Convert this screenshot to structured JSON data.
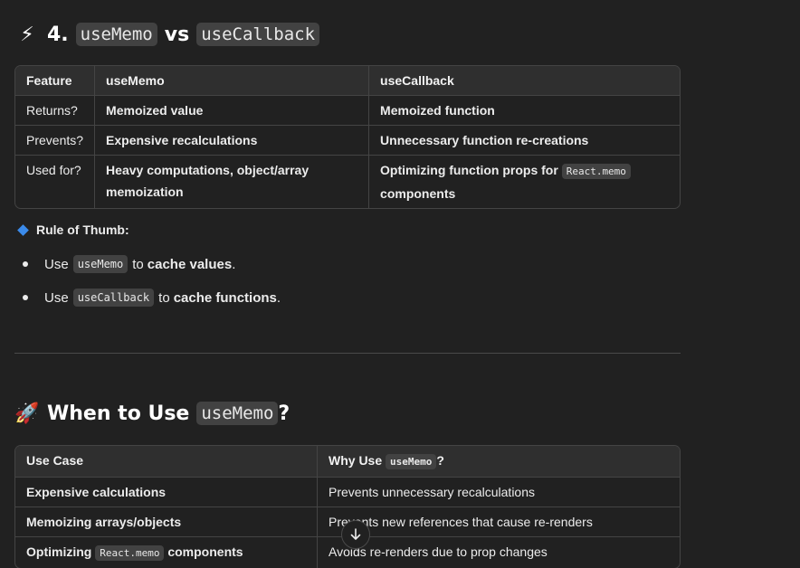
{
  "section1": {
    "emoji": "⚡",
    "number": "4.",
    "code_a": "useMemo",
    "vs": "vs",
    "code_b": "useCallback"
  },
  "table1": {
    "headers": [
      "Feature",
      "useMemo",
      "useCallback"
    ],
    "rows": [
      {
        "feature": "Returns?",
        "memo": "Memoized value",
        "callback": "Memoized function"
      },
      {
        "feature": "Prevents?",
        "memo": "Expensive recalculations",
        "callback": "Unnecessary function re-creations"
      },
      {
        "feature": "Used for?",
        "memo": "Heavy computations, object/array memoization",
        "callback_pre": "Optimizing function props for",
        "callback_code": "React.memo",
        "callback_post": "components"
      }
    ]
  },
  "rule": {
    "label": "Rule of Thumb:",
    "items": [
      {
        "pre": "Use",
        "code": "useMemo",
        "mid": "to",
        "bold": "cache values",
        "post": "."
      },
      {
        "pre": "Use",
        "code": "useCallback",
        "mid": "to",
        "bold": "cache functions",
        "post": "."
      }
    ]
  },
  "section2": {
    "emoji": "🚀",
    "title_pre": "When to Use",
    "code": "useMemo",
    "title_post": "?"
  },
  "table2": {
    "headers": [
      "Use Case",
      "Why Use"
    ],
    "header_code": "useMemo",
    "header_post": "?",
    "rows": [
      {
        "case": "Expensive calculations",
        "why": "Prevents unnecessary recalculations"
      },
      {
        "case": "Memoizing arrays/objects",
        "why": "Prevents new references that cause re-renders"
      },
      {
        "case_pre": "Optimizing",
        "case_code": "React.memo",
        "case_post": "components",
        "why": "Avoids re-renders due to prop changes"
      }
    ]
  },
  "scroll_down_icon": "arrow-down-icon"
}
